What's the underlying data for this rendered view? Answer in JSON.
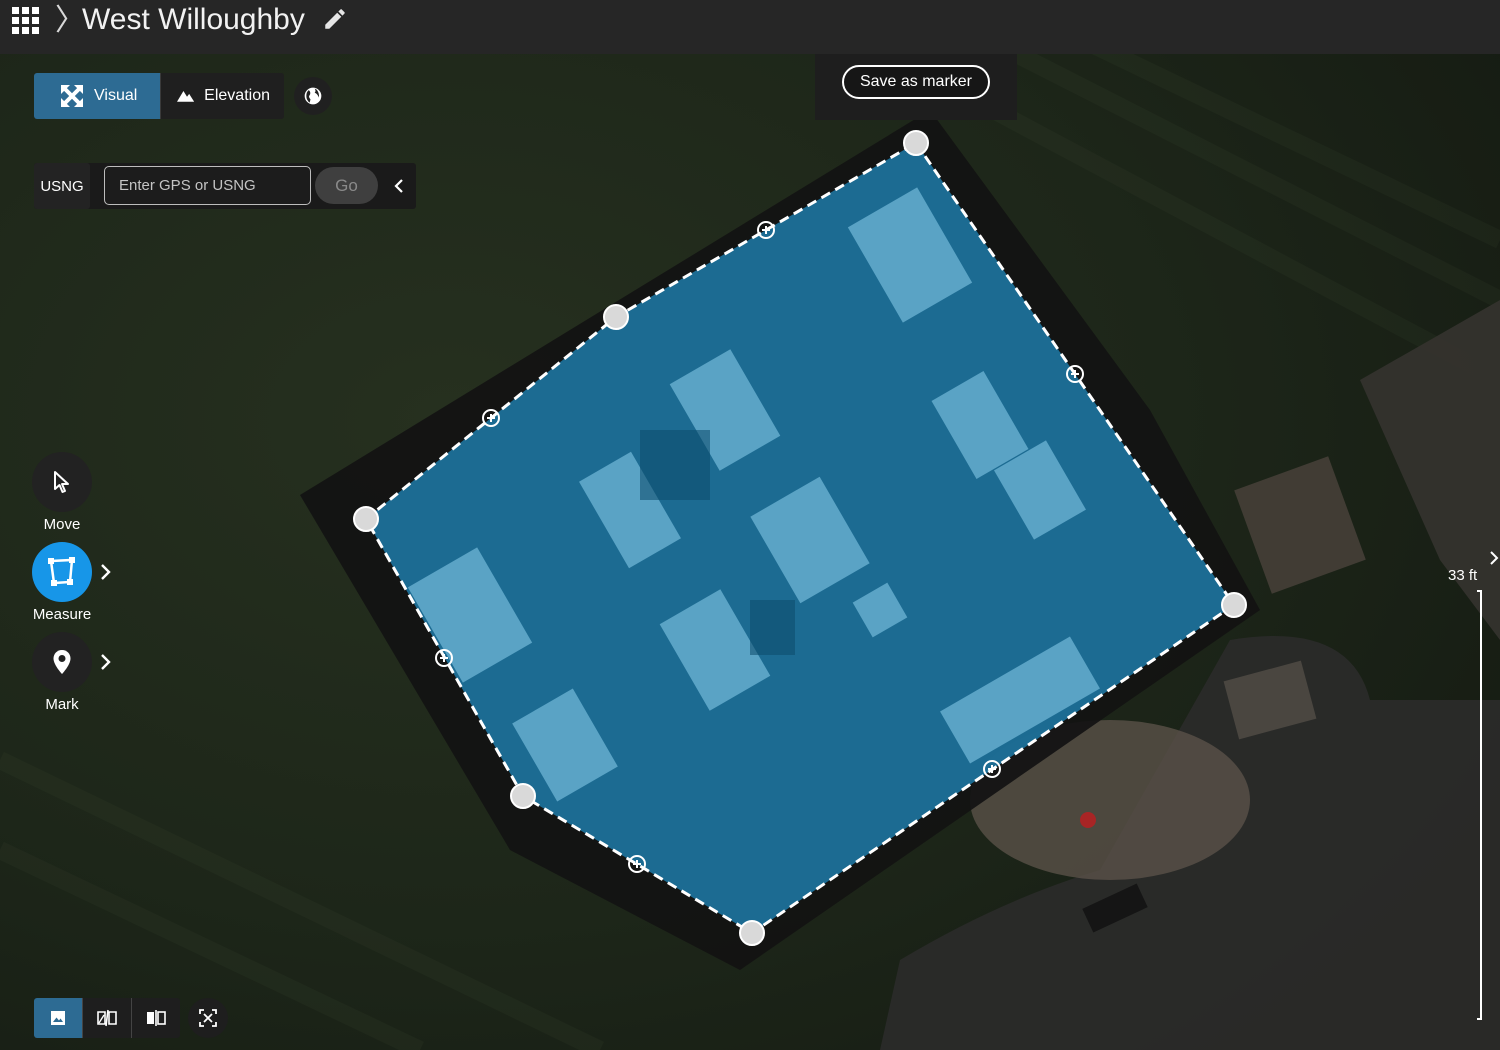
{
  "header": {
    "project_title": "West Willoughby"
  },
  "view_toggle": {
    "visual_label": "Visual",
    "elevation_label": "Elevation",
    "active": "Visual"
  },
  "marker": {
    "save_label": "Save as marker"
  },
  "search": {
    "coord_system": "USNG",
    "placeholder": "Enter GPS or USNG",
    "value": "",
    "go_label": "Go"
  },
  "tools": {
    "move_label": "Move",
    "measure_label": "Measure",
    "mark_label": "Mark",
    "active": "Measure"
  },
  "bottom_toolbar": {
    "items": [
      "image-view-icon",
      "compare-split-icon",
      "side-by-side-icon",
      "zoom-extent-icon"
    ],
    "active": "image-view-icon"
  },
  "scale": {
    "label": "33 ft"
  },
  "colors": {
    "accent": "#1796e8",
    "toggle_active": "#2d6b93",
    "polygon_fill": "#1e7fae",
    "topbar": "#262626"
  },
  "icons": {
    "apps": "apps-grid-icon",
    "edit": "pencil-icon",
    "globe": "globe-icon"
  }
}
